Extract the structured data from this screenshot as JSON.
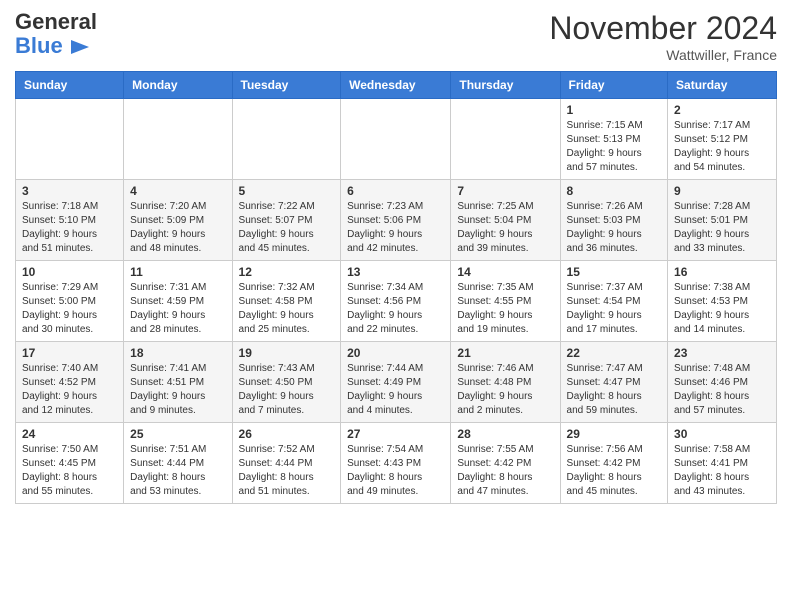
{
  "logo": {
    "general": "General",
    "blue": "Blue"
  },
  "header": {
    "month": "November 2024",
    "location": "Wattwiller, France"
  },
  "weekdays": [
    "Sunday",
    "Monday",
    "Tuesday",
    "Wednesday",
    "Thursday",
    "Friday",
    "Saturday"
  ],
  "weeks": [
    [
      {
        "day": "",
        "info": ""
      },
      {
        "day": "",
        "info": ""
      },
      {
        "day": "",
        "info": ""
      },
      {
        "day": "",
        "info": ""
      },
      {
        "day": "",
        "info": ""
      },
      {
        "day": "1",
        "info": "Sunrise: 7:15 AM\nSunset: 5:13 PM\nDaylight: 9 hours\nand 57 minutes."
      },
      {
        "day": "2",
        "info": "Sunrise: 7:17 AM\nSunset: 5:12 PM\nDaylight: 9 hours\nand 54 minutes."
      }
    ],
    [
      {
        "day": "3",
        "info": "Sunrise: 7:18 AM\nSunset: 5:10 PM\nDaylight: 9 hours\nand 51 minutes."
      },
      {
        "day": "4",
        "info": "Sunrise: 7:20 AM\nSunset: 5:09 PM\nDaylight: 9 hours\nand 48 minutes."
      },
      {
        "day": "5",
        "info": "Sunrise: 7:22 AM\nSunset: 5:07 PM\nDaylight: 9 hours\nand 45 minutes."
      },
      {
        "day": "6",
        "info": "Sunrise: 7:23 AM\nSunset: 5:06 PM\nDaylight: 9 hours\nand 42 minutes."
      },
      {
        "day": "7",
        "info": "Sunrise: 7:25 AM\nSunset: 5:04 PM\nDaylight: 9 hours\nand 39 minutes."
      },
      {
        "day": "8",
        "info": "Sunrise: 7:26 AM\nSunset: 5:03 PM\nDaylight: 9 hours\nand 36 minutes."
      },
      {
        "day": "9",
        "info": "Sunrise: 7:28 AM\nSunset: 5:01 PM\nDaylight: 9 hours\nand 33 minutes."
      }
    ],
    [
      {
        "day": "10",
        "info": "Sunrise: 7:29 AM\nSunset: 5:00 PM\nDaylight: 9 hours\nand 30 minutes."
      },
      {
        "day": "11",
        "info": "Sunrise: 7:31 AM\nSunset: 4:59 PM\nDaylight: 9 hours\nand 28 minutes."
      },
      {
        "day": "12",
        "info": "Sunrise: 7:32 AM\nSunset: 4:58 PM\nDaylight: 9 hours\nand 25 minutes."
      },
      {
        "day": "13",
        "info": "Sunrise: 7:34 AM\nSunset: 4:56 PM\nDaylight: 9 hours\nand 22 minutes."
      },
      {
        "day": "14",
        "info": "Sunrise: 7:35 AM\nSunset: 4:55 PM\nDaylight: 9 hours\nand 19 minutes."
      },
      {
        "day": "15",
        "info": "Sunrise: 7:37 AM\nSunset: 4:54 PM\nDaylight: 9 hours\nand 17 minutes."
      },
      {
        "day": "16",
        "info": "Sunrise: 7:38 AM\nSunset: 4:53 PM\nDaylight: 9 hours\nand 14 minutes."
      }
    ],
    [
      {
        "day": "17",
        "info": "Sunrise: 7:40 AM\nSunset: 4:52 PM\nDaylight: 9 hours\nand 12 minutes."
      },
      {
        "day": "18",
        "info": "Sunrise: 7:41 AM\nSunset: 4:51 PM\nDaylight: 9 hours\nand 9 minutes."
      },
      {
        "day": "19",
        "info": "Sunrise: 7:43 AM\nSunset: 4:50 PM\nDaylight: 9 hours\nand 7 minutes."
      },
      {
        "day": "20",
        "info": "Sunrise: 7:44 AM\nSunset: 4:49 PM\nDaylight: 9 hours\nand 4 minutes."
      },
      {
        "day": "21",
        "info": "Sunrise: 7:46 AM\nSunset: 4:48 PM\nDaylight: 9 hours\nand 2 minutes."
      },
      {
        "day": "22",
        "info": "Sunrise: 7:47 AM\nSunset: 4:47 PM\nDaylight: 8 hours\nand 59 minutes."
      },
      {
        "day": "23",
        "info": "Sunrise: 7:48 AM\nSunset: 4:46 PM\nDaylight: 8 hours\nand 57 minutes."
      }
    ],
    [
      {
        "day": "24",
        "info": "Sunrise: 7:50 AM\nSunset: 4:45 PM\nDaylight: 8 hours\nand 55 minutes."
      },
      {
        "day": "25",
        "info": "Sunrise: 7:51 AM\nSunset: 4:44 PM\nDaylight: 8 hours\nand 53 minutes."
      },
      {
        "day": "26",
        "info": "Sunrise: 7:52 AM\nSunset: 4:44 PM\nDaylight: 8 hours\nand 51 minutes."
      },
      {
        "day": "27",
        "info": "Sunrise: 7:54 AM\nSunset: 4:43 PM\nDaylight: 8 hours\nand 49 minutes."
      },
      {
        "day": "28",
        "info": "Sunrise: 7:55 AM\nSunset: 4:42 PM\nDaylight: 8 hours\nand 47 minutes."
      },
      {
        "day": "29",
        "info": "Sunrise: 7:56 AM\nSunset: 4:42 PM\nDaylight: 8 hours\nand 45 minutes."
      },
      {
        "day": "30",
        "info": "Sunrise: 7:58 AM\nSunset: 4:41 PM\nDaylight: 8 hours\nand 43 minutes."
      }
    ]
  ]
}
